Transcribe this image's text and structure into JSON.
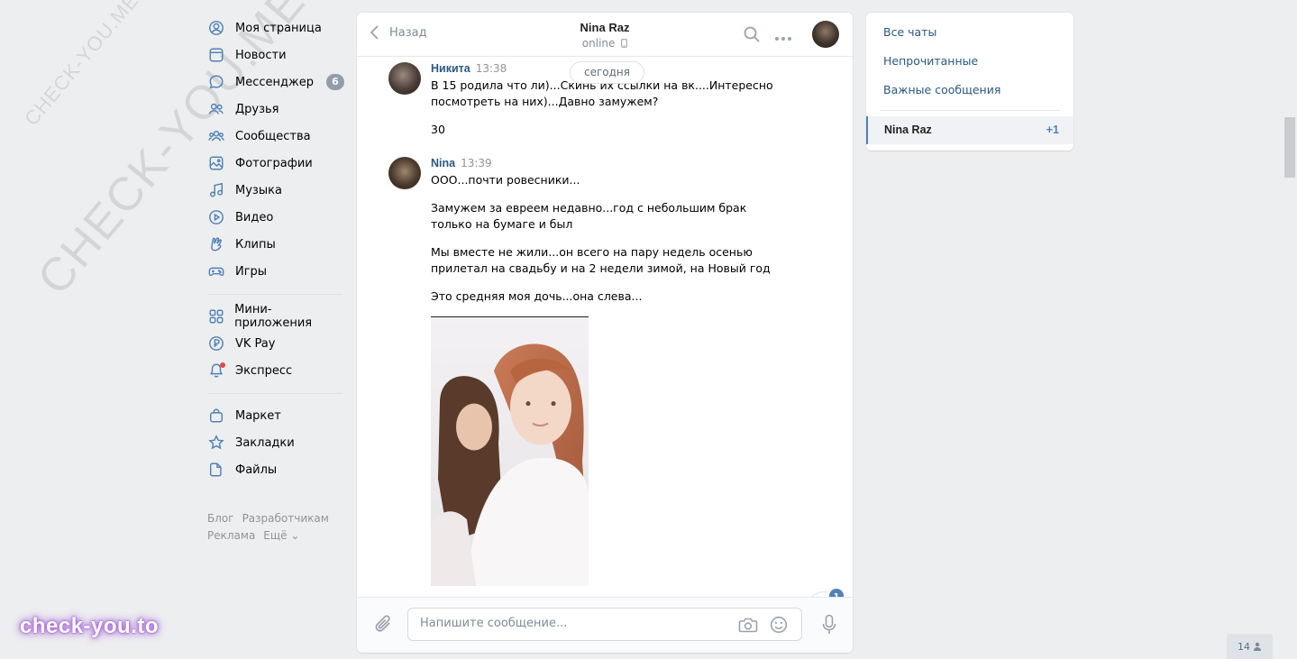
{
  "watermarks": {
    "top_small": "CHECK-YOU.ME",
    "top_big": "CHECK-YOU.ME",
    "bottom": "check-you.to"
  },
  "left_nav": {
    "group1": [
      {
        "label": "Моя страница",
        "icon": "user-circle-icon"
      },
      {
        "label": "Новости",
        "icon": "news-icon"
      },
      {
        "label": "Мессенджер",
        "icon": "message-icon",
        "badge": "6"
      },
      {
        "label": "Друзья",
        "icon": "friends-icon"
      },
      {
        "label": "Сообщества",
        "icon": "communities-icon"
      },
      {
        "label": "Фотографии",
        "icon": "photos-icon"
      },
      {
        "label": "Музыка",
        "icon": "music-icon"
      },
      {
        "label": "Видео",
        "icon": "video-icon"
      },
      {
        "label": "Клипы",
        "icon": "clips-icon"
      },
      {
        "label": "Игры",
        "icon": "games-icon"
      }
    ],
    "group2": [
      {
        "label": "Мини-приложения",
        "icon": "mini-apps-icon"
      },
      {
        "label": "VK Pay",
        "icon": "vk-pay-icon"
      },
      {
        "label": "Экспресс",
        "icon": "express-icon"
      }
    ],
    "group3": [
      {
        "label": "Маркет",
        "icon": "market-icon"
      },
      {
        "label": "Закладки",
        "icon": "bookmarks-icon"
      },
      {
        "label": "Файлы",
        "icon": "files-icon"
      }
    ],
    "footer": {
      "blog": "Блог",
      "developers": "Разработчикам",
      "ads": "Реклама",
      "more": "Ещё ⌄"
    }
  },
  "chat": {
    "back_label": "Назад",
    "peer_name": "Nina Raz",
    "peer_status": "online",
    "date_pill": "сегодня",
    "messages": [
      {
        "author": "Никита",
        "time": "13:38",
        "texts": [
          "В 15 родила что ли)...Скинь их ссылки на вк....Интересно посмотреть на них)...Давно замужем?",
          "30"
        ]
      },
      {
        "author": "Nina",
        "time": "13:39",
        "texts": [
          "ООО...почти ровесники...",
          "Замужем за евреем недавно...год с небольшим брак только на бумаге и был",
          "Мы вместе не жили...он всего на пару недель осенью прилетал на свадьбу и на 2 недели зимой, на Новый год",
          "Это средняя моя дочь...она слева..."
        ]
      }
    ],
    "unread_badge": "1",
    "composer": {
      "placeholder": "Напишите сообщение..."
    }
  },
  "right_panel": {
    "all_chats": "Все чаты",
    "unread": "Непрочитанные",
    "important": "Важные сообщения",
    "active_chat": "Nina Raz",
    "active_count": "+1"
  },
  "online_counter": "14",
  "colors": {
    "accent": "#5181b8",
    "link": "#2a5885",
    "background": "#edeef0"
  }
}
